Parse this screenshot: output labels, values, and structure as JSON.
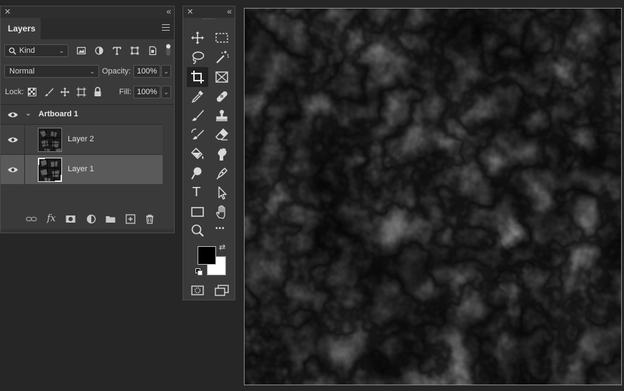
{
  "layers_panel": {
    "close_glyph": "✕",
    "collapse_glyph": "«",
    "tab_label": "Layers",
    "filter": {
      "kind_label": "Kind"
    },
    "blend_mode": "Normal",
    "opacity_label": "Opacity:",
    "opacity_value": "100%",
    "lock_label": "Lock:",
    "fill_label": "Fill:",
    "fill_value": "100%",
    "artboard": {
      "name": "Artboard 1"
    },
    "layers": [
      {
        "name": "Layer 2",
        "selected": false
      },
      {
        "name": "Layer 1",
        "selected": true
      }
    ],
    "footer_icons": [
      "link-icon",
      "fx-icon",
      "mask-icon",
      "adjustment-icon",
      "folder-icon",
      "new-layer-icon",
      "trash-icon"
    ],
    "fx_glyph": "fx"
  },
  "tools_panel": {
    "close_glyph": "✕",
    "collapse_glyph": "«",
    "text_tool_glyph": "T",
    "more_glyph": "•••",
    "swap_glyph": "⇄",
    "foreground_color": "#000000",
    "background_color": "#ffffff",
    "active_tool": "crop-tool"
  },
  "colors": {
    "panel_bg": "#3a3a3a",
    "app_bg": "#262626",
    "selected_layer": "#5a5a5a"
  }
}
